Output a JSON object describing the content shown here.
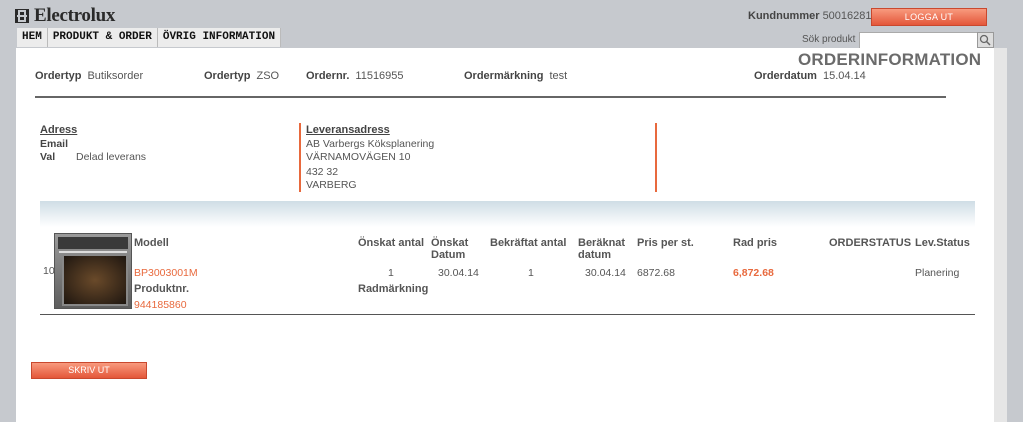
{
  "header": {
    "brand": "Electrolux",
    "customer_label": "Kundnummer",
    "customer_number": "50016281",
    "logout_label": "LOGGA UT"
  },
  "nav": {
    "items": [
      {
        "label": "HEM"
      },
      {
        "label": "PRODUKT & ORDER"
      },
      {
        "label": "ÖVRIG INFORMATION"
      }
    ]
  },
  "search": {
    "label": "Sök produkt",
    "placeholder": ""
  },
  "page": {
    "title": "ORDERINFORMATION"
  },
  "order_header": {
    "ordertyp1_label": "Ordertyp",
    "ordertyp1_value": "Butiksorder",
    "ordertyp2_label": "Ordertyp",
    "ordertyp2_value": "ZSO",
    "ordernr_label": "Ordernr.",
    "ordernr_value": "11516955",
    "ordermarkning_label": "Ordermärkning",
    "ordermarkning_value": "test",
    "orderdatum_label": "Orderdatum",
    "orderdatum_value": "15.04.14"
  },
  "address": {
    "title": "Adress",
    "email_label": "Email",
    "val_label": "Val",
    "val_value": "Delad leverans"
  },
  "delivery": {
    "title": "Leveransadress",
    "lines": [
      "AB Varbergs Köksplanering",
      "VÄRNAMOVÄGEN 10",
      "432 32",
      "VARBERG"
    ]
  },
  "table": {
    "headers": {
      "modell": "Modell",
      "onskat_antal": "Önskat antal",
      "onskat_datum": [
        "Önskat",
        "Datum"
      ],
      "bekraftat_antal": "Bekräftat antal",
      "beraknat_datum": [
        "Beräknat",
        "datum"
      ],
      "pris_per_st": "Pris per st.",
      "rad_pris": "Rad pris",
      "orderstatus": "ORDERSTATUS",
      "lev_status": "Lev.Status",
      "produktnr": "Produktnr.",
      "radmarkning": "Radmärkning"
    },
    "row": {
      "line_no": "10",
      "model": "BP3003001M",
      "onskat_antal": "1",
      "onskat_datum": "30.04.14",
      "bekraftat_antal": "1",
      "beraknat_datum": "30.04.14",
      "pris_per_st": "6872.68",
      "rad_pris": "6,872.68",
      "lev_status": "Planering",
      "produktnr": "944185860"
    }
  },
  "actions": {
    "print_label": "SKRIV UT"
  },
  "colors": {
    "accent": "#e8693d",
    "background": "#c6c9ce"
  }
}
